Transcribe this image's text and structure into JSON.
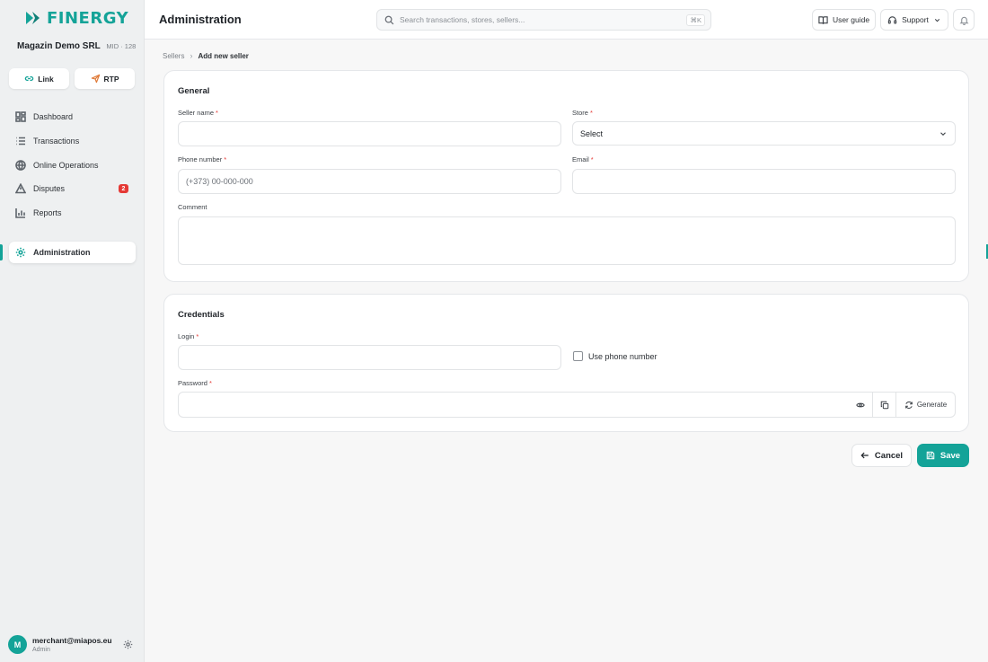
{
  "brand": {
    "name": "FINERGY",
    "accent": "#14a398"
  },
  "merchant": {
    "name": "Magazin Demo SRL",
    "mid": "MID · 128"
  },
  "quick_actions": [
    {
      "label": "Link",
      "icon": "link-icon"
    },
    {
      "label": "RTP",
      "icon": "send-icon"
    }
  ],
  "nav": {
    "items": [
      {
        "label": "Dashboard",
        "icon": "dashboard-icon"
      },
      {
        "label": "Transactions",
        "icon": "list-icon"
      },
      {
        "label": "Online Operations",
        "icon": "globe-icon"
      },
      {
        "label": "Disputes",
        "icon": "alert-triangle-icon",
        "badge": "2"
      },
      {
        "label": "Reports",
        "icon": "bar-chart-icon"
      }
    ],
    "active": {
      "label": "Administration",
      "icon": "gear-icon"
    }
  },
  "user": {
    "initial": "M",
    "email": "merchant@miapos.eu",
    "role": "Admin"
  },
  "header": {
    "title": "Administration",
    "search_placeholder": "Search transactions, stores, sellers...",
    "shortcut": "⌘K",
    "user_guide": "User guide",
    "support": "Support"
  },
  "breadcrumb": {
    "parent": "Sellers",
    "current": "Add new seller"
  },
  "general": {
    "title": "General",
    "seller_name_label": "Seller name",
    "store_label": "Store",
    "store_value": "Select",
    "phone_label": "Phone number",
    "phone_placeholder": "(+373) 00-000-000",
    "email_label": "Email",
    "comment_label": "Comment",
    "required_mark": "*"
  },
  "credentials": {
    "title": "Credentials",
    "login_label": "Login",
    "use_phone_label": "Use phone number",
    "password_label": "Password",
    "generate_label": "Generate"
  },
  "actions": {
    "cancel": "Cancel",
    "save": "Save"
  }
}
